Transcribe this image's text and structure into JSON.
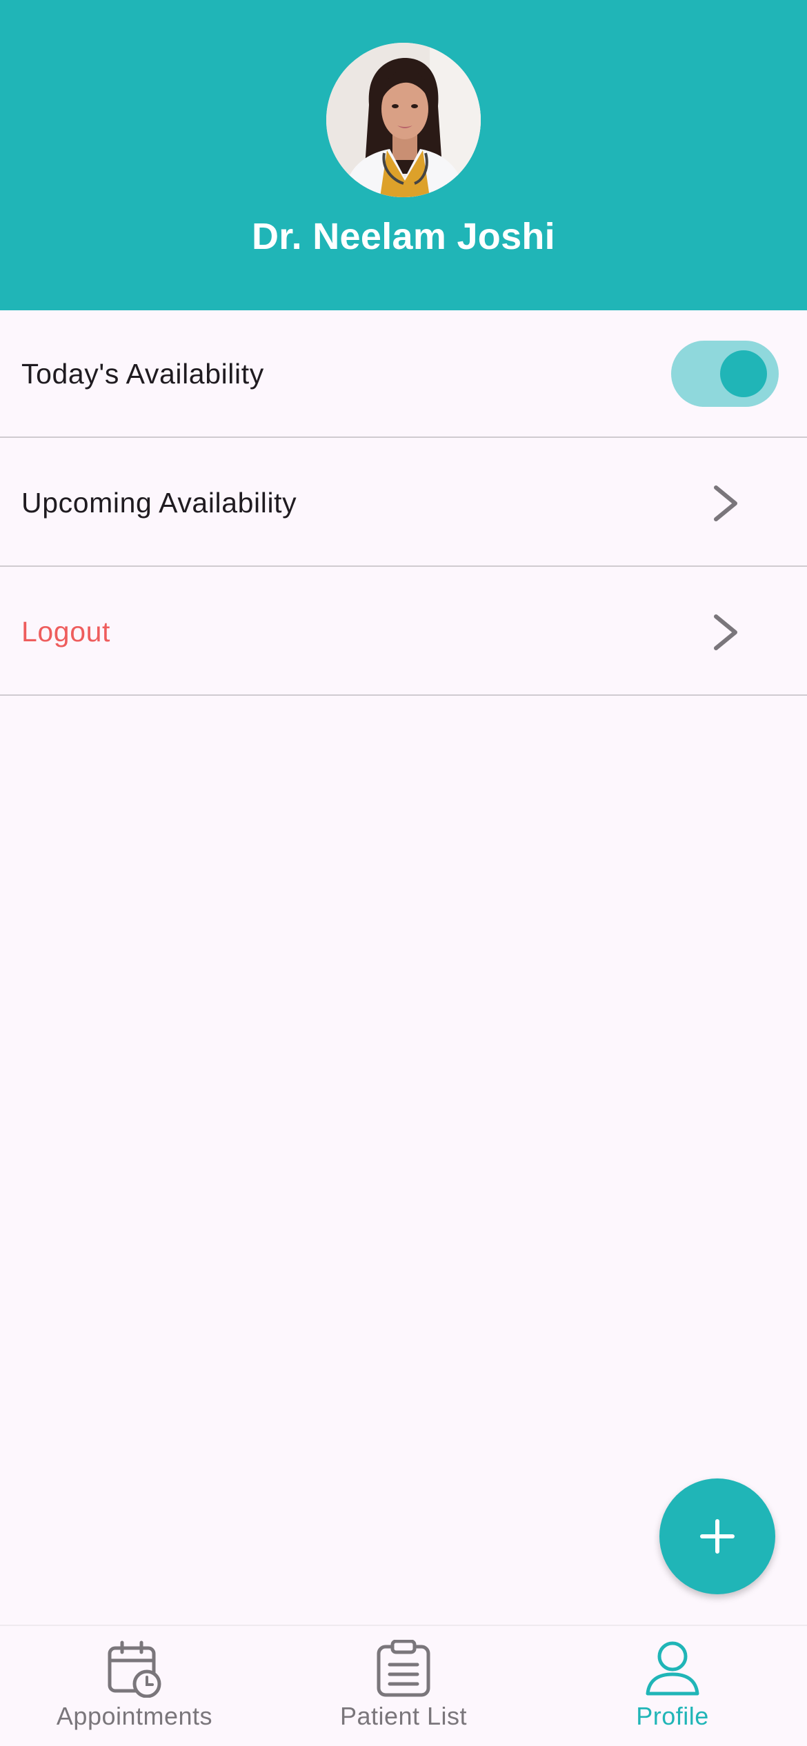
{
  "profile": {
    "name": "Dr. Neelam Joshi",
    "avatar_icon": "doctor-portrait"
  },
  "settings": [
    {
      "label": "Today's Availability",
      "control": "toggle",
      "toggle_on": true
    },
    {
      "label": "Upcoming Availability",
      "control": "chevron-right-icon"
    },
    {
      "label": "Logout",
      "control": "chevron-right-icon",
      "color": "#ee5d5d"
    }
  ],
  "fab": {
    "icon": "plus-icon"
  },
  "bottom_nav": {
    "items": [
      {
        "label": "Appointments",
        "icon": "calendar-clock-icon",
        "active": false
      },
      {
        "label": "Patient List",
        "icon": "clipboard-icon",
        "active": false
      },
      {
        "label": "Profile",
        "icon": "person-icon",
        "active": true
      }
    ]
  },
  "colors": {
    "primary": "#20b5b7",
    "toggle_track": "#8fd8dc",
    "background": "#fdf7fd",
    "danger": "#ee5d5d",
    "inactive": "#7a767b"
  }
}
